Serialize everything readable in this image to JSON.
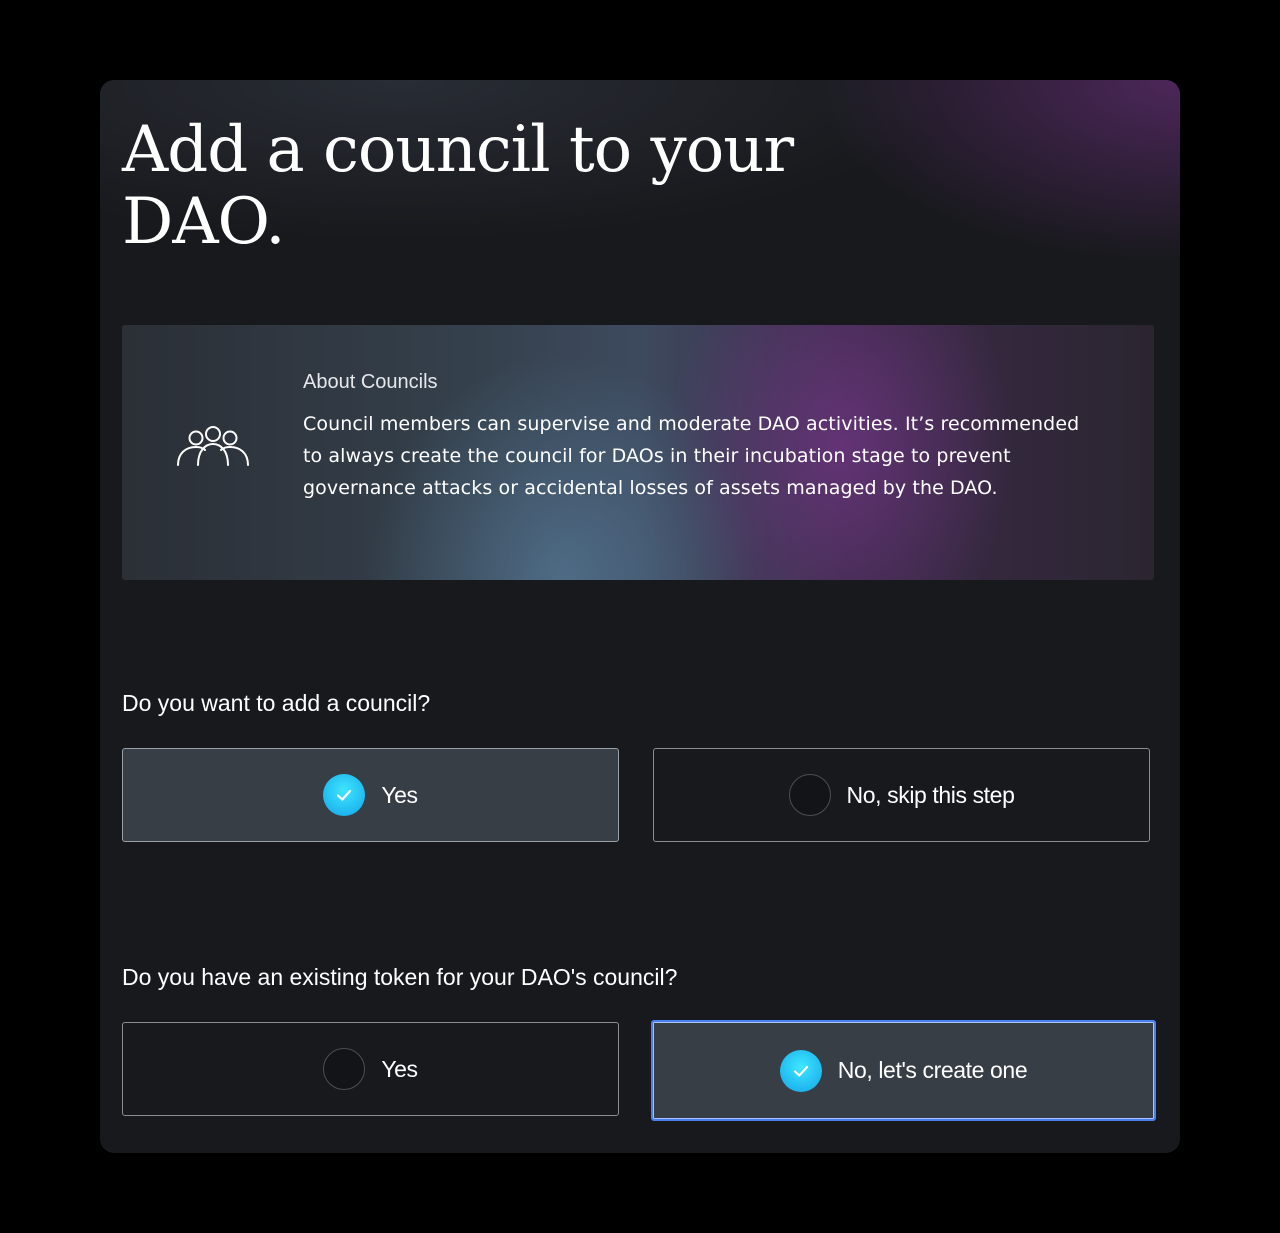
{
  "page": {
    "title": "Add a council to your DAO."
  },
  "about": {
    "icon": "people-group-icon",
    "title": "About Councils",
    "text": "Council members can supervise and moderate DAO activities. It’s recommended to always create the council for DAOs in their incubation stage to prevent governance attacks or accidental losses of assets managed by the DAO."
  },
  "questions": [
    {
      "label": "Do you want to add a council?",
      "options": [
        {
          "label": "Yes",
          "selected": true
        },
        {
          "label": "No, skip this step",
          "selected": false
        }
      ]
    },
    {
      "label": "Do you have an existing token for your DAO's council?",
      "options": [
        {
          "label": "Yes",
          "selected": false
        },
        {
          "label": "No, let's create one",
          "selected": true
        }
      ]
    }
  ],
  "colors": {
    "background": "#000000",
    "card": "#18191d",
    "selected_option": "#383e46",
    "radio_checked": "#1fb8f0",
    "focus_border": "#4a7ff0"
  }
}
